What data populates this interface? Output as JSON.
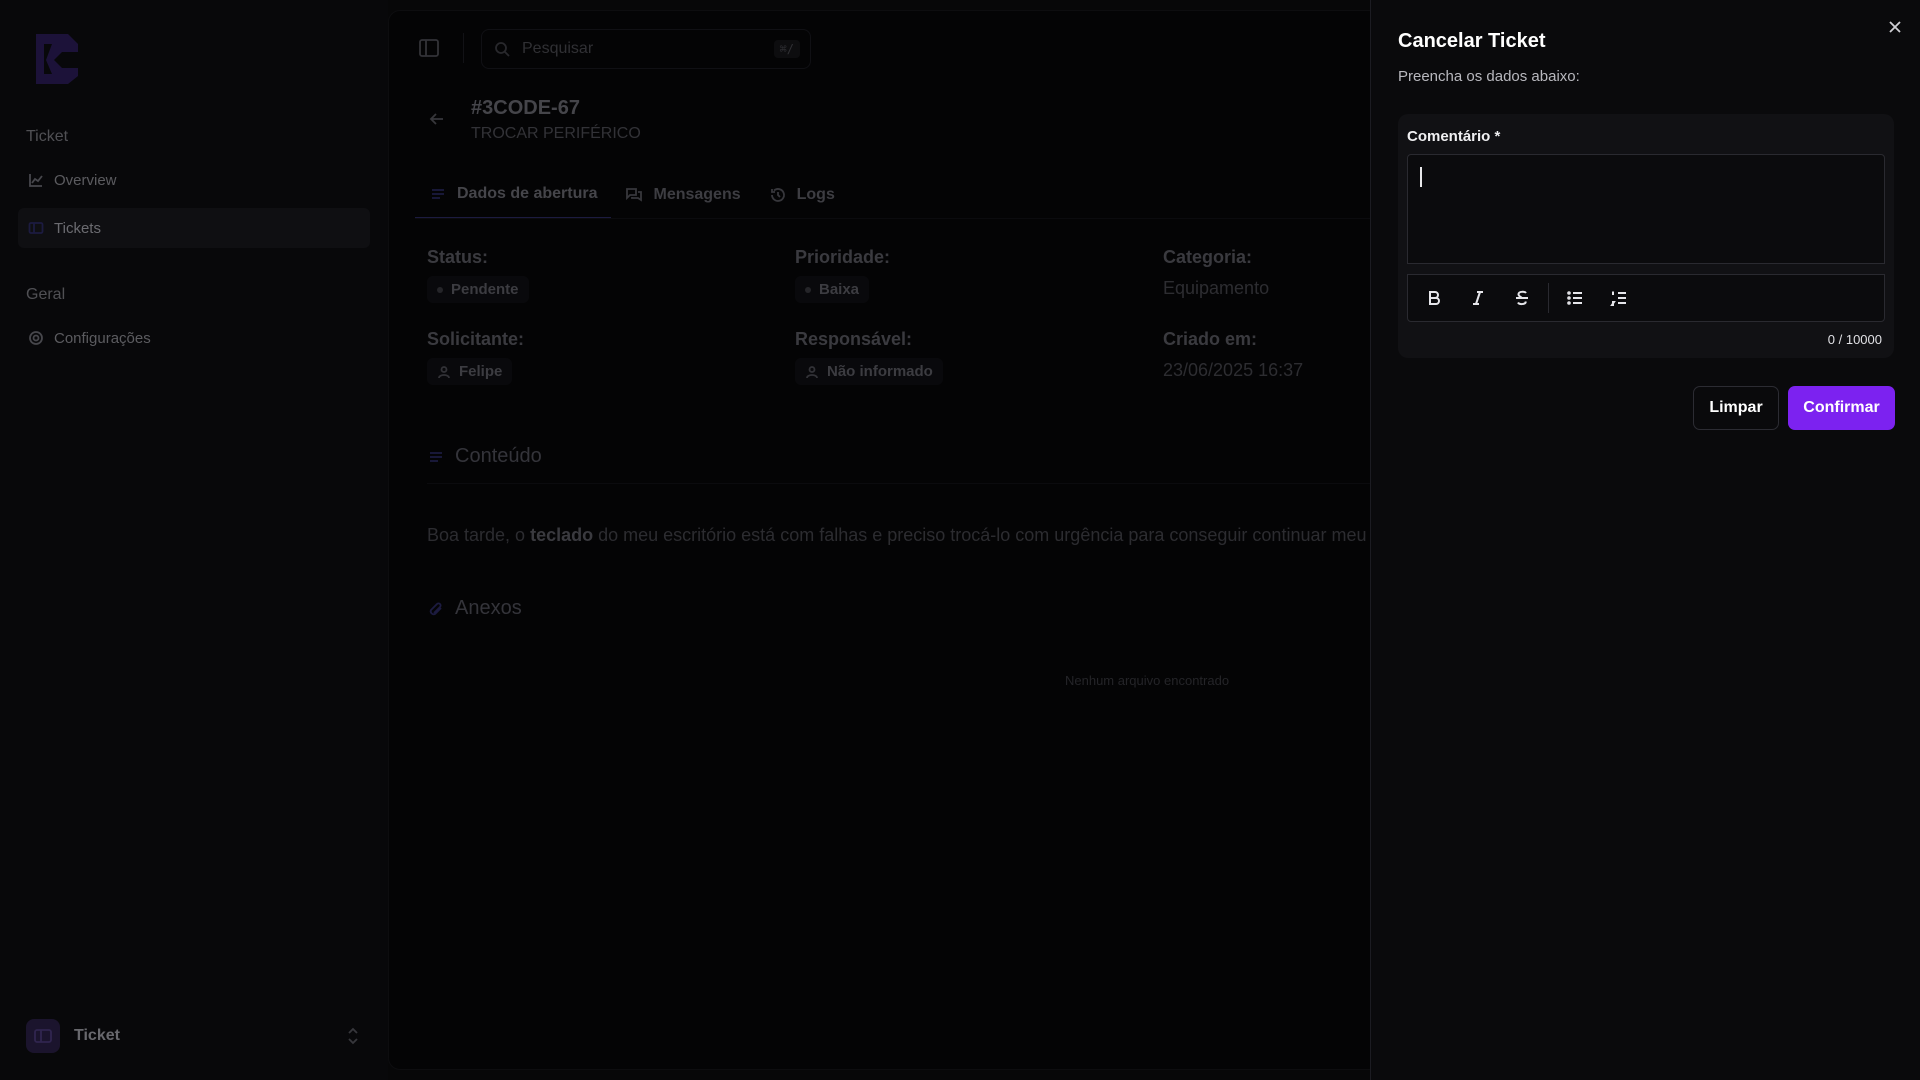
{
  "sidebar": {
    "groups": [
      {
        "title": "Ticket"
      },
      {
        "title": "Geral"
      }
    ],
    "items": [
      {
        "label": "Overview",
        "icon": "chart-line-icon"
      },
      {
        "label": "Tickets",
        "icon": "ticket-icon"
      },
      {
        "label": "Configurações",
        "icon": "gear-icon"
      }
    ],
    "workspace": {
      "label": "Ticket"
    }
  },
  "topbar": {
    "search_placeholder": "Pesquisar",
    "search_shortcut": "⌘/"
  },
  "ticket": {
    "id": "#3CODE-67",
    "subtitle": "TROCAR PERIFÉRICO"
  },
  "tabs": [
    {
      "label": "Dados de abertura",
      "icon": "list-icon",
      "active": true
    },
    {
      "label": "Mensagens",
      "icon": "messages-icon",
      "active": false
    },
    {
      "label": "Logs",
      "icon": "history-icon",
      "active": false
    }
  ],
  "fields": {
    "status": {
      "label": "Status:",
      "value": "Pendente"
    },
    "priority": {
      "label": "Prioridade:",
      "value": "Baixa"
    },
    "category": {
      "label": "Categoria:",
      "value": "Equipamento"
    },
    "requester": {
      "label": "Solicitante:",
      "value": "Felipe"
    },
    "assignee": {
      "label": "Responsável:",
      "value": "Não informado"
    },
    "created": {
      "label": "Criado em:",
      "value": "23/06/2025 16:37"
    }
  },
  "content": {
    "title": "Conteúdo",
    "text_before": "Boa tarde, o ",
    "text_bold": "teclado",
    "text_after": " do meu escritório está com falhas e preciso trocá-lo com urgência para conseguir continuar meu trab"
  },
  "attachments": {
    "title": "Anexos",
    "empty": "Nenhum arquivo encontrado"
  },
  "drawer": {
    "title": "Cancelar Ticket",
    "subtitle": "Preencha os dados abaixo:",
    "comment_label": "Comentário *",
    "comment_value": "",
    "counter": "0 / 10000",
    "clear_label": "Limpar",
    "confirm_label": "Confirmar",
    "confirm_color": "#7c22f0"
  }
}
